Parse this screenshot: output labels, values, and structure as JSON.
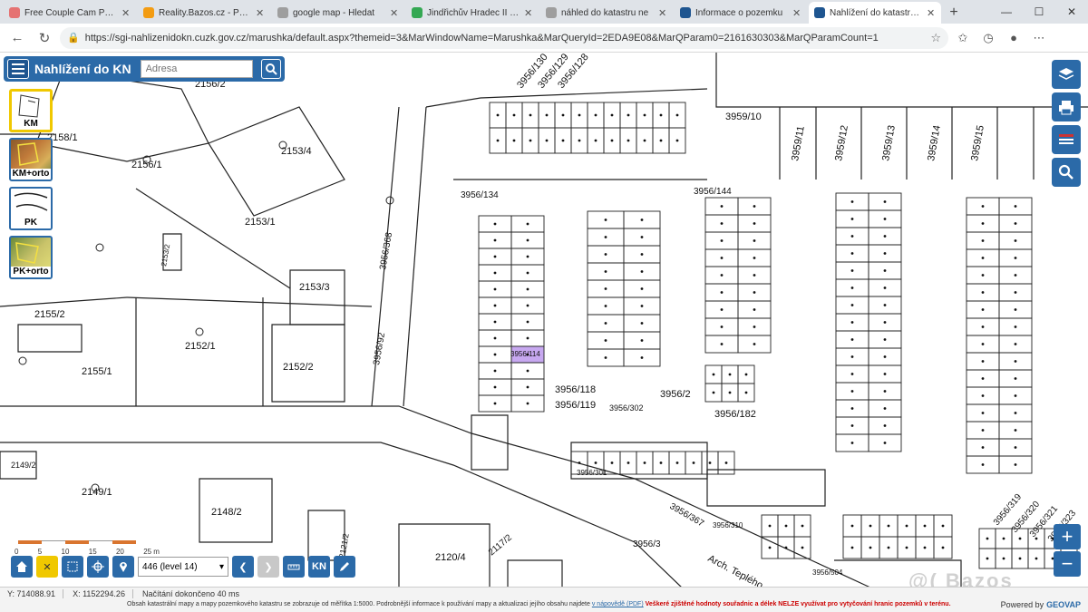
{
  "browser": {
    "tabs": [
      {
        "title": "Free Couple Cam Porn",
        "color": "#e57373",
        "active": false
      },
      {
        "title": "Reality.Bazos.cz - Přidá",
        "color": "#f39c12",
        "active": false
      },
      {
        "title": "google map - Hledat",
        "color": "#9e9e9e",
        "active": false
      },
      {
        "title": "Jindřichův Hradec II 12",
        "color": "#34a853",
        "active": false
      },
      {
        "title": "náhled do katastru ne",
        "color": "#9e9e9e",
        "active": false
      },
      {
        "title": "Informace o pozemku",
        "color": "#1e5590",
        "active": false
      },
      {
        "title": "Nahlížení do katastru n",
        "color": "#1e5590",
        "active": true
      }
    ],
    "url": "https://sgi-nahlizenidokn.cuzk.gov.cz/marushka/default.aspx?themeid=3&MarWindowName=Marushka&MarQueryId=2EDA9E08&MarQParam0=2161630303&MarQParamCount=1"
  },
  "app": {
    "title": "Nahlížení do KN",
    "search_placeholder": "Adresa",
    "layers": [
      {
        "label": "KM",
        "active": true
      },
      {
        "label": "KM+orto",
        "active": false
      },
      {
        "label": "PK",
        "active": false
      },
      {
        "label": "PK+orto",
        "active": false
      }
    ],
    "zoom_select": "446 (level 14)",
    "bottom_kn": "KN",
    "scale_ticks": [
      "0",
      "5",
      "10",
      "15",
      "20",
      "25 m"
    ],
    "status": {
      "y": "Y: 714088.91",
      "x": "X: 1152294.26",
      "load": "Načítání dokončeno 40 ms",
      "disclaimer": "Obsah katastrální mapy a mapy pozemkového katastru se zobrazuje od měřítka 1:5000. Podrobnější informace k používání mapy a aktualizaci jejího obsahu najdete",
      "link": "v nápovědě (PDF)",
      "warning": "Veškeré zjištěné hodnoty souřadnic a délek NELZE využívat pro vytyčování hranic pozemků v terénu.",
      "powered_prefix": "Powered by",
      "powered_brand": "GEOVAP"
    },
    "watermark": "@( Bazos"
  },
  "map_labels": {
    "parcels_large": [
      {
        "t": "2156/2"
      },
      {
        "t": "2158/1"
      },
      {
        "t": "2156/1"
      },
      {
        "t": "2153/4"
      },
      {
        "t": "2153/1"
      },
      {
        "t": "2153/2"
      },
      {
        "t": "2153/3"
      },
      {
        "t": "2155/2"
      },
      {
        "t": "2152/1"
      },
      {
        "t": "2155/1"
      },
      {
        "t": "2152/2"
      },
      {
        "t": "3956/368"
      },
      {
        "t": "3956/92"
      },
      {
        "t": "2149/2"
      },
      {
        "t": "2149/1"
      },
      {
        "t": "2148/2"
      },
      {
        "t": "2121/2"
      },
      {
        "t": "2120/4"
      },
      {
        "t": "2117/2"
      },
      {
        "t": "3956/3"
      },
      {
        "t": "3956/367"
      },
      {
        "t": "Arch. Teplého"
      },
      {
        "t": "3959/10"
      },
      {
        "t": "3959/11"
      },
      {
        "t": "3959/12"
      },
      {
        "t": "3959/13"
      },
      {
        "t": "3959/14"
      },
      {
        "t": "3959/15"
      },
      {
        "t": "3956/134"
      },
      {
        "t": "3956/144"
      },
      {
        "t": "3956/118"
      },
      {
        "t": "3956/119"
      },
      {
        "t": "3956/2"
      },
      {
        "t": "3956/182"
      },
      {
        "t": "3956/302"
      },
      {
        "t": "3956/301"
      },
      {
        "t": "3956/310"
      },
      {
        "t": "3956/504"
      },
      {
        "t": "3956/319"
      },
      {
        "t": "3956/320"
      },
      {
        "t": "3956/321"
      },
      {
        "t": "3956/323"
      },
      {
        "t": "3956/130"
      },
      {
        "t": "3956/129"
      },
      {
        "t": "3956/128"
      }
    ],
    "highlighted_parcel": "3956/114"
  }
}
